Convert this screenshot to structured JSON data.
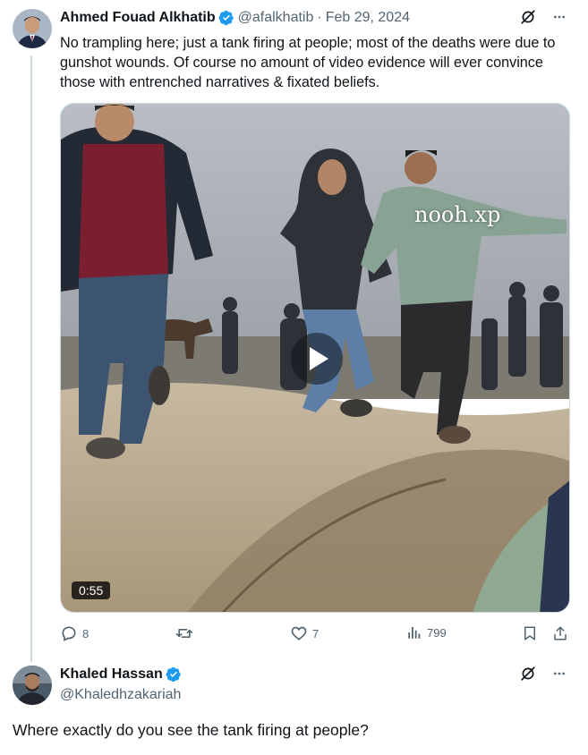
{
  "tweet": {
    "author_name": "Ahmed Fouad Alkhatib",
    "handle": "@afalkhatib",
    "separator": "·",
    "date": "Feb 29, 2024",
    "text": "No trampling here; just a tank firing at people; most of the deaths were due to gunshot wounds. Of course no amount of video evidence will ever convince those with entrenched narratives & fixated beliefs.",
    "media": {
      "watermark": "nooh.xp",
      "duration": "0:55"
    },
    "actions": {
      "replies": "8",
      "reposts": "",
      "likes": "7",
      "views": "799"
    }
  },
  "reply": {
    "author_name": "Khaled Hassan",
    "handle": "@Khaledhzakariah",
    "text": "Where exactly do you see the tank firing at people?"
  },
  "colors": {
    "verified": "#1d9bf0",
    "secondary_text": "#536471",
    "thread_line": "#cfd9de"
  }
}
